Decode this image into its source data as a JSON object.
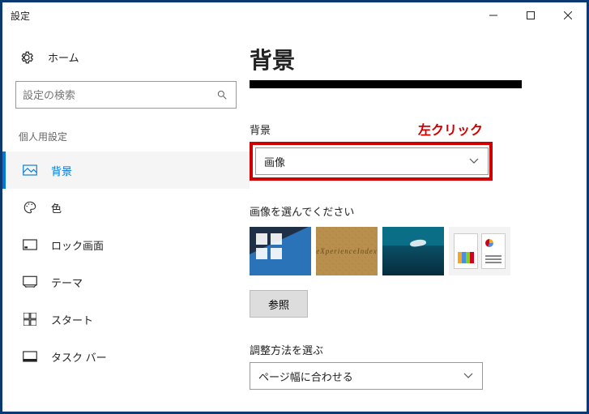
{
  "window": {
    "title": "設定"
  },
  "sidebar": {
    "home": "ホーム",
    "search_placeholder": "設定の検索",
    "section": "個人用設定",
    "items": [
      {
        "id": "background",
        "label": "背景"
      },
      {
        "id": "color",
        "label": "色"
      },
      {
        "id": "lockscreen",
        "label": "ロック画面"
      },
      {
        "id": "themes",
        "label": "テーマ"
      },
      {
        "id": "start",
        "label": "スタート"
      },
      {
        "id": "taskbar",
        "label": "タスク バー"
      }
    ]
  },
  "content": {
    "title": "背景",
    "annotation": "左クリック",
    "bg_label": "背景",
    "bg_value": "画像",
    "choose_label": "画像を選んでください",
    "thumbs": {
      "cork_text": "eXperienceIndex"
    },
    "browse": "参照",
    "fit_label": "調整方法を選ぶ",
    "fit_value": "ページ幅に合わせる"
  }
}
